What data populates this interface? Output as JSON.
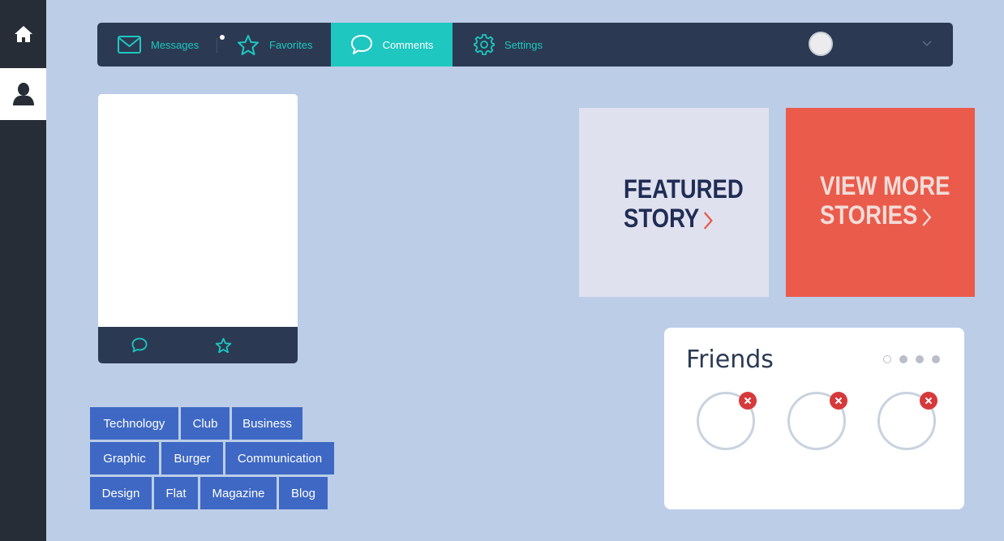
{
  "rail": {
    "home_icon": "home-icon",
    "user_icon": "user-icon"
  },
  "nav": {
    "messages": "Messages",
    "favorites": "Favorites",
    "comments": "Comments",
    "settings": "Settings"
  },
  "tags": {
    "rows": [
      [
        "Technology",
        "Club",
        "Business"
      ],
      [
        "Graphic",
        "Burger",
        "Communication"
      ],
      [
        "Design",
        "Flat",
        "Magazine",
        "Blog"
      ]
    ]
  },
  "tiles": {
    "featured_line1": "FEATURED",
    "featured_line2": "STORY",
    "more_line1": "VIEW MORE",
    "more_line2": "STORIES"
  },
  "friends": {
    "title": "Friends",
    "pages": 4,
    "active_page": 1
  },
  "colors": {
    "background": "#bccde8",
    "nav": "#2b3a52",
    "accent": "#1ec7c0",
    "tag": "#3e68c4",
    "coral": "#ea5b4b",
    "remove": "#d6393b"
  }
}
